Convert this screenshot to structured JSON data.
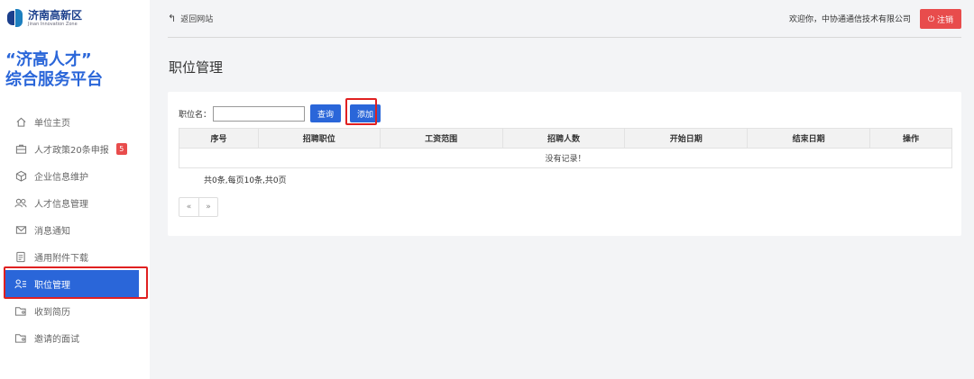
{
  "logo": {
    "zh": "济南高新区",
    "en": "Jinan Innovation Zone"
  },
  "platform": {
    "line1": "“济高人才”",
    "line2": "综合服务平台"
  },
  "nav": [
    {
      "label": "单位主页",
      "icon": "home-icon"
    },
    {
      "label": "人才政策20条申报",
      "icon": "briefcase-icon",
      "badge": "5"
    },
    {
      "label": "企业信息维护",
      "icon": "cube-icon"
    },
    {
      "label": "人才信息管理",
      "icon": "users-icon"
    },
    {
      "label": "消息通知",
      "icon": "envelope-icon"
    },
    {
      "label": "通用附件下载",
      "icon": "document-icon"
    },
    {
      "label": "职位管理",
      "icon": "person-list-icon",
      "active": true
    },
    {
      "label": "收到简历",
      "icon": "folder-user-icon"
    },
    {
      "label": "邀请的面试",
      "icon": "folder-user-icon"
    }
  ],
  "topbar": {
    "back_label": "返回网站",
    "welcome": "欢迎你，中协通通信技术有限公司",
    "logout_label": "注销"
  },
  "page": {
    "title": "职位管理"
  },
  "search": {
    "label": "职位名：",
    "value": "",
    "query_label": "查询",
    "add_label": "添加"
  },
  "table": {
    "headers": [
      "序号",
      "招聘职位",
      "工资范围",
      "招聘人数",
      "开始日期",
      "结束日期",
      "操作"
    ],
    "empty_text": "没有记录！"
  },
  "pagination": {
    "summary": "共0条,每页10条,共0页",
    "prev": "«",
    "next": "»"
  },
  "colors": {
    "accent": "#2a66d9",
    "danger": "#e84c4c",
    "highlight": "#e02020"
  }
}
